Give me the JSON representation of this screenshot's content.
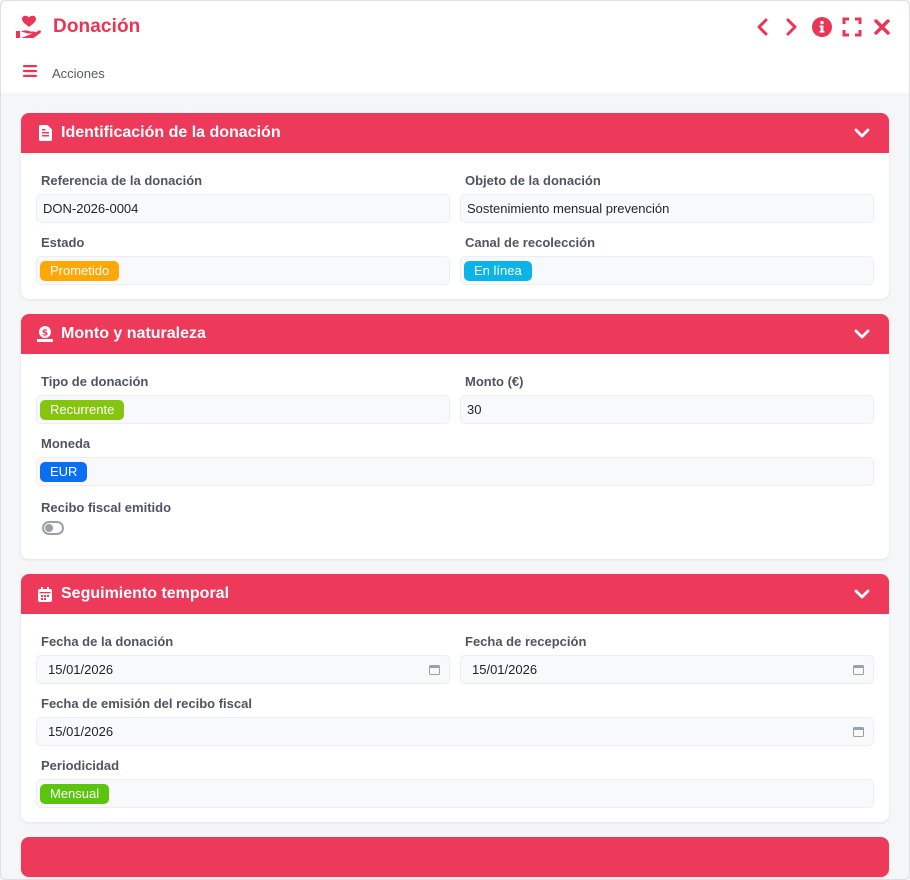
{
  "window": {
    "title": "Donación"
  },
  "actions": {
    "label": "Acciones"
  },
  "colors": {
    "accent": "#ea3654",
    "header": "#ee3a5a"
  },
  "sections": {
    "identificacion": {
      "title": "Identificación de la donación",
      "referencia": {
        "label": "Referencia de la donación",
        "value": "DON-2026-0004"
      },
      "objeto": {
        "label": "Objeto de la donación",
        "value": "Sostenimiento mensual prevención"
      },
      "estado": {
        "label": "Estado",
        "value": "Prometido",
        "color": "#ffa705"
      },
      "canal": {
        "label": "Canal de recolección",
        "value": "En línea",
        "color": "#0ab4e6"
      }
    },
    "monto": {
      "title": "Monto y naturaleza",
      "tipo": {
        "label": "Tipo de donación",
        "value": "Recurrente",
        "color": "#85c50d"
      },
      "monto": {
        "label": "Monto (€)",
        "value": "30"
      },
      "moneda": {
        "label": "Moneda",
        "value": "EUR",
        "color": "#0a6ff0"
      },
      "recibo": {
        "label": "Recibo fiscal emitido",
        "checked": false
      }
    },
    "seguimiento": {
      "title": "Seguimiento temporal",
      "fecha_donacion": {
        "label": "Fecha de la donación",
        "value": "15/01/2026"
      },
      "fecha_recepcion": {
        "label": "Fecha de recepción",
        "value": "15/01/2026"
      },
      "fecha_emision": {
        "label": "Fecha de emisión del recibo fiscal",
        "value": "15/01/2026"
      },
      "periodicidad": {
        "label": "Periodicidad",
        "value": "Mensual",
        "color": "#5bc50d"
      }
    }
  }
}
